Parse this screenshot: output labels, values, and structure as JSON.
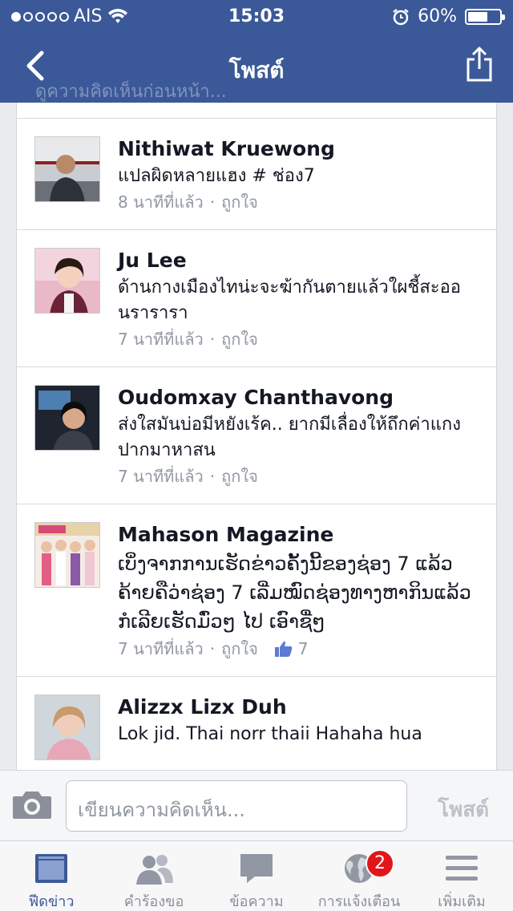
{
  "status_bar": {
    "carrier": "AIS",
    "time": "15:03",
    "battery": "60%"
  },
  "header": {
    "title": "โพสต์",
    "behind_text": "ดูความคิดเห็นก่อนหน้า..."
  },
  "comments": [
    {
      "name": "Nithiwat Kruewong",
      "text": "แปลผิดหลายแฮง # ช่อง7",
      "time": "8 นาทีที่แล้ว",
      "like": "ถูกใจ"
    },
    {
      "name": "Ju Lee",
      "text": "ด้านกางเมืองไทน่ะจะฆ้ากันตายแล้วใผชี้สะออนรารารา",
      "time": "7 นาทีที่แล้ว",
      "like": "ถูกใจ"
    },
    {
      "name": "Oudomxay Chanthavong",
      "text": "ส่งใสมันบ่อมีหยังเร้ค.. ยากมีเลื่องให้ถึกค่าแกงปากมาหาสน",
      "time": "7 นาทีที่แล้ว",
      "like": "ถูกใจ"
    },
    {
      "name": "Mahason Magazine",
      "text": "ເບິ່ງຈາກການເຮັດຂ່າວຄັ້ງນີ້ຂອງຊ່ອງ 7 ແລ້ວ ຄ້າຍຄືວ່າຊ່ອງ 7 ເລີ່ມໝົດຊ່ອງທາງຫາກິນແລ້ວ ກໍເລີຍເຮັດມົ່ວໆ ໄປ ເອົາຊື່ໆ",
      "time": "7 นาทีที่แล้ว",
      "like": "ถูกใจ",
      "like_count": "7"
    },
    {
      "name": "Alizzx Lizx Duh",
      "text": "Lok jid. Thai norr thaii Hahaha hua",
      "time": "",
      "like": ""
    }
  ],
  "composer": {
    "placeholder": "เขียนความคิดเห็น...",
    "post_label": "โพสต์"
  },
  "tabs": [
    {
      "label": "ฟีดข่าว",
      "icon": "news-feed-icon",
      "active": true
    },
    {
      "label": "คำร้องขอ",
      "icon": "friend-requests-icon"
    },
    {
      "label": "ข้อความ",
      "icon": "messages-icon"
    },
    {
      "label": "การแจ้งเตือน",
      "icon": "notifications-globe-icon",
      "badge": "2"
    },
    {
      "label": "เพิ่มเติม",
      "icon": "more-menu-icon"
    }
  ],
  "colors": {
    "brand": "#3b5998",
    "badge": "#e0161a"
  }
}
